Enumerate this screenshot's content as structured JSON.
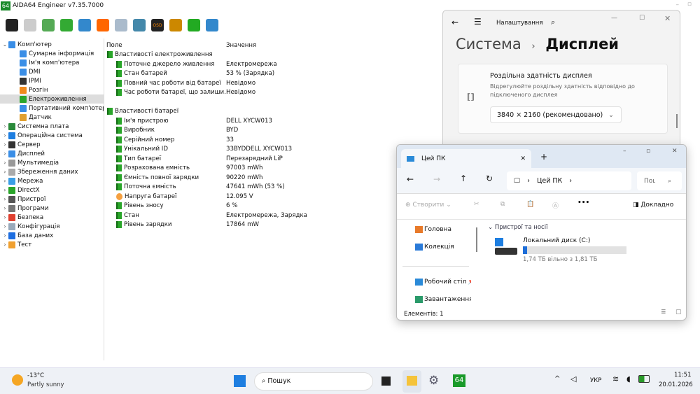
{
  "app": {
    "title": "AIDA64 Engineer v7.35.7000",
    "badge": "64"
  },
  "toolbar": {
    "icons": [
      "refresh-icon",
      "report-icon",
      "motherboard-icon",
      "memory-icon",
      "network-icon",
      "benchmark-flame-icon",
      "test-icon",
      "user-icon",
      "osd-icon",
      "gauge-icon",
      "download-icon",
      "search-icon"
    ],
    "osd_label": "OSD"
  },
  "tree": [
    {
      "label": "Комп'ютер",
      "level": 0,
      "exp": "⌄",
      "color": "#3a8ee6"
    },
    {
      "label": "Сумарна інформація",
      "level": 1,
      "color": "#3a8ee6"
    },
    {
      "label": "Ім'я комп'ютера",
      "level": 1,
      "color": "#3a8ee6"
    },
    {
      "label": "DMI",
      "level": 1,
      "color": "#3a8ee6"
    },
    {
      "label": "IPMI",
      "level": 1,
      "color": "#333"
    },
    {
      "label": "Розгін",
      "level": 1,
      "color": "#f08a1c"
    },
    {
      "label": "Електроживлення",
      "level": 1,
      "color": "#2aa52a",
      "selected": true
    },
    {
      "label": "Портативний комп'ютер",
      "level": 1,
      "color": "#3a8ee6"
    },
    {
      "label": "Датчик",
      "level": 1,
      "color": "#e0a030"
    },
    {
      "label": "Системна плата",
      "level": 0,
      "exp": "›",
      "color": "#2a8a3a"
    },
    {
      "label": "Операційна система",
      "level": 0,
      "exp": "›",
      "color": "#1e7ee0"
    },
    {
      "label": "Сервер",
      "level": 0,
      "exp": "›",
      "color": "#333"
    },
    {
      "label": "Дисплей",
      "level": 0,
      "exp": "›",
      "color": "#3a8ee6"
    },
    {
      "label": "Мультимедіа",
      "level": 0,
      "exp": "›",
      "color": "#999"
    },
    {
      "label": "Збереження даних",
      "level": 0,
      "exp": "›",
      "color": "#aaa"
    },
    {
      "label": "Мережа",
      "level": 0,
      "exp": "›",
      "color": "#3a9ee6"
    },
    {
      "label": "DirectX",
      "level": 0,
      "exp": "›",
      "color": "#2aa52a"
    },
    {
      "label": "Пристрої",
      "level": 0,
      "exp": "›",
      "color": "#555"
    },
    {
      "label": "Програми",
      "level": 0,
      "exp": "›",
      "color": "#777"
    },
    {
      "label": "Безпека",
      "level": 0,
      "exp": "›",
      "color": "#e04030"
    },
    {
      "label": "Конфігурація",
      "level": 0,
      "exp": "›",
      "color": "#9ab"
    },
    {
      "label": "База даних",
      "level": 0,
      "exp": "›",
      "color": "#1e6ee0"
    },
    {
      "label": "Тест",
      "level": 0,
      "exp": "›",
      "color": "#f0a030"
    }
  ],
  "list": {
    "headers": {
      "field": "Поле",
      "value": "Значення"
    },
    "groups": [
      {
        "title": "Властивості електроживлення",
        "rows": [
          [
            "Поточне джерело живлення",
            "Електромережа"
          ],
          [
            "Стан батарей",
            "53 % (Зарядка)"
          ],
          [
            "Повний час роботи від батареї",
            "Невідомо"
          ],
          [
            "Час роботи батареї, що залиши...",
            "Невідомо"
          ]
        ]
      },
      {
        "title": "Властивості батареї",
        "rows": [
          [
            "Ім'я пристрою",
            "DELL XYCW013"
          ],
          [
            "Виробник",
            "BYD"
          ],
          [
            "Серійний номер",
            "33"
          ],
          [
            "Унікальний ID",
            "33BYDDELL XYCW013"
          ],
          [
            "Тип батареї",
            "Перезарядний LiP"
          ],
          [
            "Розрахована ємність",
            "97003 mWh"
          ],
          [
            "Ємність повної зарядки",
            "90220 mWh"
          ],
          [
            "Поточна ємність",
            "47641 mWh  (53 %)"
          ],
          [
            "Напруга батареї",
            "12.095 V"
          ],
          [
            "Рівень зносу",
            "6 %"
          ],
          [
            "Стан",
            "Електромережа, Зарядка"
          ],
          [
            "Рівень зарядки",
            "17864 mW"
          ]
        ]
      }
    ]
  },
  "settings": {
    "app_name": "Налаштування",
    "crumb_parent": "Система",
    "crumb_current": "Дисплей",
    "card_title": "Роздільна здатність дисплея",
    "card_desc_1": "Відрегулюйте роздільну здатність відповідно до",
    "card_desc_2": " підключеного дисплея",
    "resolution": "3840 × 2160 (рекомендовано)"
  },
  "explorer": {
    "tab": "Цей ПК",
    "address": "Цей ПК",
    "search_placeholder": "Пош",
    "new_label": "Створити",
    "details_label": "Докладно",
    "nav": [
      "Головна",
      "Колекція",
      "Робочий стіл",
      "Завантаження"
    ],
    "section": "Пристрої та носії",
    "drive_name": "Локальний диск (C:)",
    "drive_free": "1,74 ТБ вільно з 1,81 ТБ",
    "drive_used_fraction": 0.04,
    "status": "Елементів: 1"
  },
  "taskbar": {
    "temp": "-13°C",
    "weather": "Partly sunny",
    "search": "Пошук",
    "lang": "УКР",
    "time": "11:51",
    "date": "20.01.2026",
    "aida_badge": "64"
  }
}
